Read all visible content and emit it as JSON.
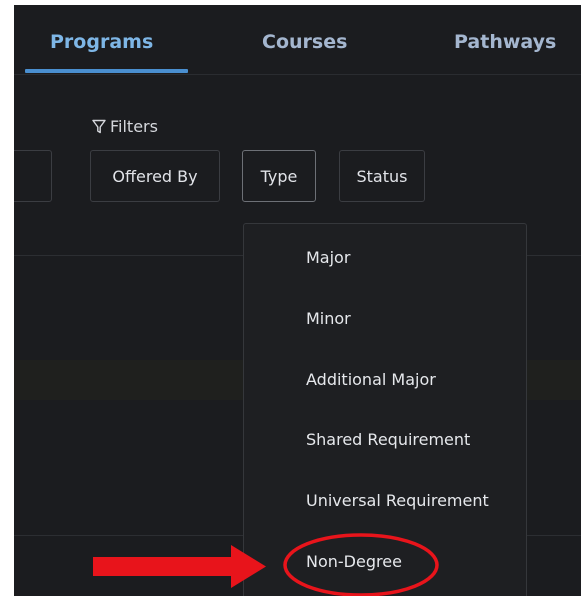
{
  "tabs": [
    {
      "label": "Programs",
      "active": true
    },
    {
      "label": "Courses",
      "active": false
    },
    {
      "label": "Pathways",
      "active": false
    }
  ],
  "filters": {
    "label": "Filters",
    "icon": "funnel-icon",
    "chips": [
      "Offered By",
      "Type",
      "Status"
    ],
    "active_chip": "Type"
  },
  "type_dropdown": {
    "options": [
      "Major",
      "Minor",
      "Additional Major",
      "Shared Requirement",
      "Universal Requirement",
      "Non-Degree"
    ],
    "highlighted_option": "Non-Degree"
  },
  "colors": {
    "background": "#1b1c1f",
    "active_tab": "#7eb6e6",
    "tab_underline": "#4a8fd0",
    "annotation": "#e8141b"
  }
}
